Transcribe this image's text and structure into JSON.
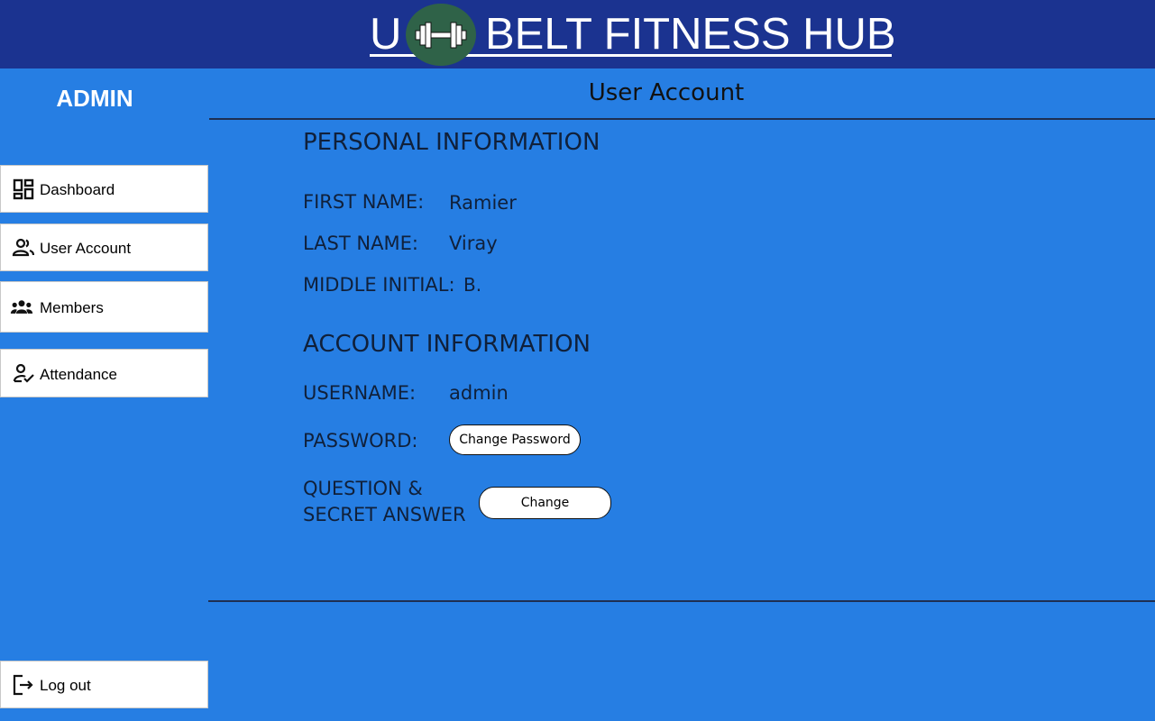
{
  "header": {
    "brand_part1": "U",
    "brand_part2": "BELT FITNESS HUB",
    "logo_icon": "dumbbell-icon",
    "bg_color": "#1b3390"
  },
  "sidebar": {
    "role_label": "ADMIN",
    "items": [
      {
        "label": "Dashboard",
        "icon": "dashboard-icon"
      },
      {
        "label": "User Account",
        "icon": "user-account-icon"
      },
      {
        "label": "Members",
        "icon": "members-icon"
      },
      {
        "label": "Attendance",
        "icon": "attendance-icon"
      }
    ],
    "logout_label": "Log out",
    "logout_icon": "logout-icon"
  },
  "main": {
    "title": "User Account",
    "personal": {
      "heading": "PERSONAL INFORMATION",
      "first_name_label": "FIRST NAME:",
      "first_name_value": "Ramier",
      "last_name_label": "LAST NAME:",
      "last_name_value": "Viray",
      "middle_initial_label": "MIDDLE INITIAL:",
      "middle_initial_value": "B."
    },
    "account": {
      "heading": "ACCOUNT INFORMATION",
      "username_label": "USERNAME:",
      "username_value": "admin",
      "password_label": "PASSWORD:",
      "change_password_button": "Change Password",
      "question_label_line1": "QUESTION &",
      "question_label_line2": "SECRET ANSWER",
      "change_button": "Change"
    }
  },
  "colors": {
    "background": "#267ee3",
    "header": "#1b3390",
    "logo_circle": "#2f6248"
  }
}
